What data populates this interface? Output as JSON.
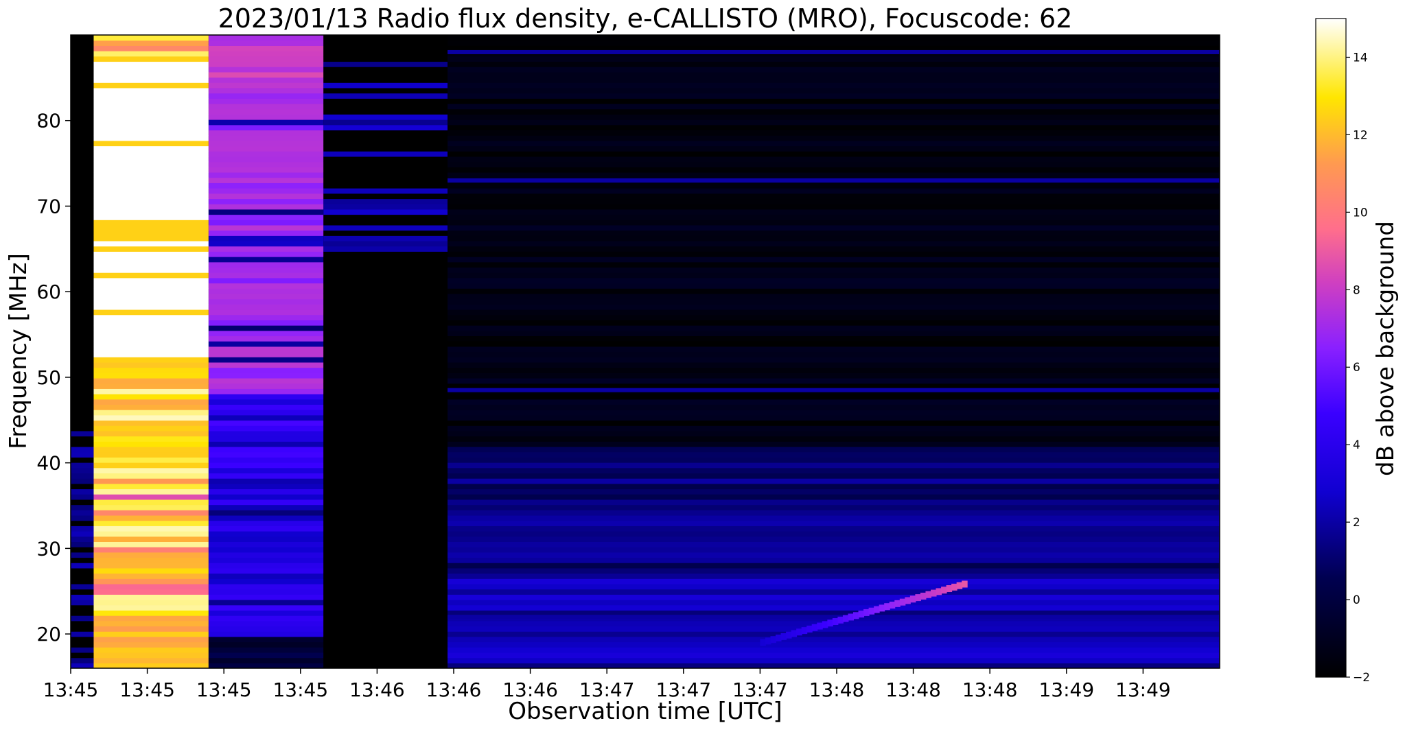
{
  "chart_data": {
    "type": "heatmap",
    "title": "2023/01/13  Radio flux density, e-CALLISTO (MRO), Focuscode: 62",
    "xlabel": "Observation time [UTC]",
    "ylabel": "Frequency [MHz]",
    "colorbar_label": "dB above background",
    "colormap": "gnuplot2",
    "colors": {
      "low": "#000000",
      "mid_low": "#1400ff",
      "mid": "#8c1eff",
      "mid_high": "#ff6e8c",
      "high": "#ffe600",
      "max": "#ffffff"
    },
    "x_tick_labels": [
      "13:45",
      "13:45",
      "13:45",
      "13:45",
      "13:46",
      "13:46",
      "13:46",
      "13:47",
      "13:47",
      "13:47",
      "13:48",
      "13:48",
      "13:48",
      "13:49",
      "13:49"
    ],
    "ylim": [
      16,
      90
    ],
    "y_ticks": [
      20,
      30,
      40,
      50,
      60,
      70,
      80
    ],
    "clim": [
      -2,
      15
    ],
    "colorbar_ticks": [
      -2,
      0,
      2,
      4,
      6,
      8,
      10,
      12,
      14
    ],
    "time_segments": [
      {
        "start": 0.0,
        "end": 0.02,
        "level": "low",
        "description_values": [
          -2,
          1
        ]
      },
      {
        "start": 0.02,
        "end": 0.12,
        "level": "saturated",
        "dB_range": [
          10,
          15
        ]
      },
      {
        "start": 0.12,
        "end": 0.22,
        "level": "elevated",
        "dB_range": [
          3,
          9
        ]
      },
      {
        "start": 0.22,
        "end": 0.328,
        "level": "background",
        "dB_range": [
          -2,
          1
        ]
      },
      {
        "start": 0.328,
        "end": 1.0,
        "level": "quiet",
        "dB_range": [
          -2,
          3
        ]
      }
    ],
    "features": [
      {
        "name": "drifting burst",
        "time_frac": [
          0.6,
          0.78
        ],
        "freq_mhz": [
          19,
          26
        ],
        "peak_dB": 9
      },
      {
        "name": "interference line",
        "freq_mhz": 73,
        "dB": 2
      },
      {
        "name": "interference line",
        "freq_mhz": 88,
        "dB": 2
      },
      {
        "name": "interference line",
        "freq_mhz": 48.5,
        "dB": 2
      },
      {
        "name": "interference line",
        "freq_mhz": 22,
        "dB": 2
      }
    ]
  }
}
